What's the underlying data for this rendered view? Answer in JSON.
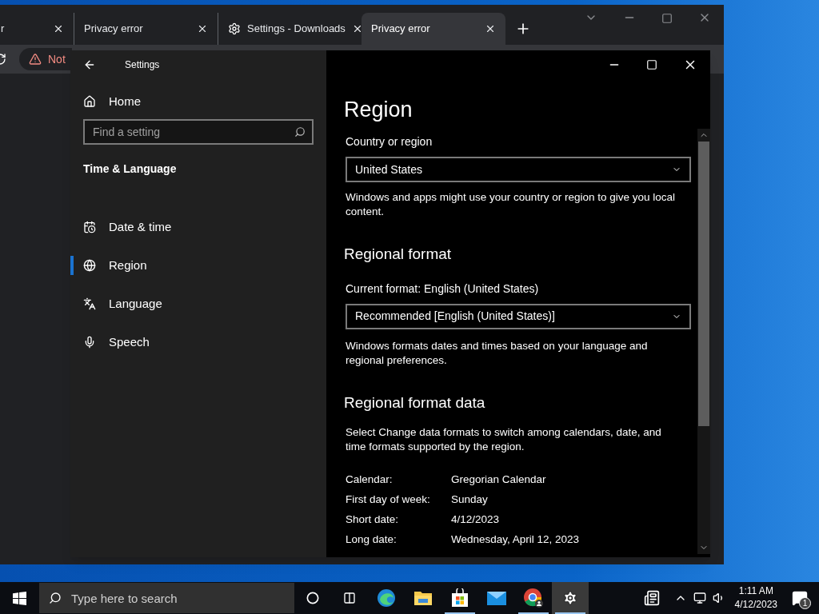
{
  "browser": {
    "tabs": [
      {
        "label": "r",
        "kind": "page",
        "selected": false
      },
      {
        "label": "Privacy error",
        "kind": "page",
        "selected": false
      },
      {
        "label": "Settings - Downloads",
        "kind": "settings",
        "selected": false
      },
      {
        "label": "Privacy error",
        "kind": "page",
        "selected": true
      }
    ],
    "security_chip": "Not"
  },
  "settings": {
    "title": "Settings",
    "home": "Home",
    "search": {
      "placeholder": "Find a setting"
    },
    "section": "Time & Language",
    "nav": [
      {
        "label": "Date & time",
        "kind": "calendar",
        "selected": false
      },
      {
        "label": "Region",
        "kind": "globe",
        "selected": true
      },
      {
        "label": "Language",
        "kind": "language",
        "selected": false
      },
      {
        "label": "Speech",
        "kind": "mic",
        "selected": false
      }
    ],
    "page_title": "Region",
    "country": {
      "label": "Country or region",
      "value": "United States",
      "note": "Windows and apps might use your country or region to give you local content."
    },
    "regional_format": {
      "heading": "Regional format",
      "label": "Current format: English (United States)",
      "value": "Recommended [English (United States)]",
      "note": "Windows formats dates and times based on your language and regional preferences."
    },
    "format_data": {
      "heading": "Regional format data",
      "note": "Select Change data formats to switch among calendars, date, and time formats supported by the region.",
      "rows": [
        {
          "label": "Calendar:",
          "value": "Gregorian Calendar"
        },
        {
          "label": "First day of week:",
          "value": "Sunday"
        },
        {
          "label": "Short date:",
          "value": "4/12/2023"
        },
        {
          "label": "Long date:",
          "value": "Wednesday, April 12, 2023"
        }
      ]
    }
  },
  "taskbar": {
    "search": {
      "placeholder": "Type here to search"
    },
    "apps": [
      {
        "kind": "cortana",
        "open": false,
        "selected": false
      },
      {
        "kind": "taskview",
        "open": false,
        "selected": false
      },
      {
        "kind": "edge",
        "open": false,
        "selected": false
      },
      {
        "kind": "explorer",
        "open": false,
        "selected": false
      },
      {
        "kind": "store",
        "open": true,
        "selected": false
      },
      {
        "kind": "mail",
        "open": false,
        "selected": false
      },
      {
        "kind": "chrome",
        "open": true,
        "selected": false
      },
      {
        "kind": "settings",
        "open": true,
        "selected": true
      }
    ],
    "time": "1:11 AM",
    "date": "4/12/2023",
    "notification_count": "1"
  }
}
